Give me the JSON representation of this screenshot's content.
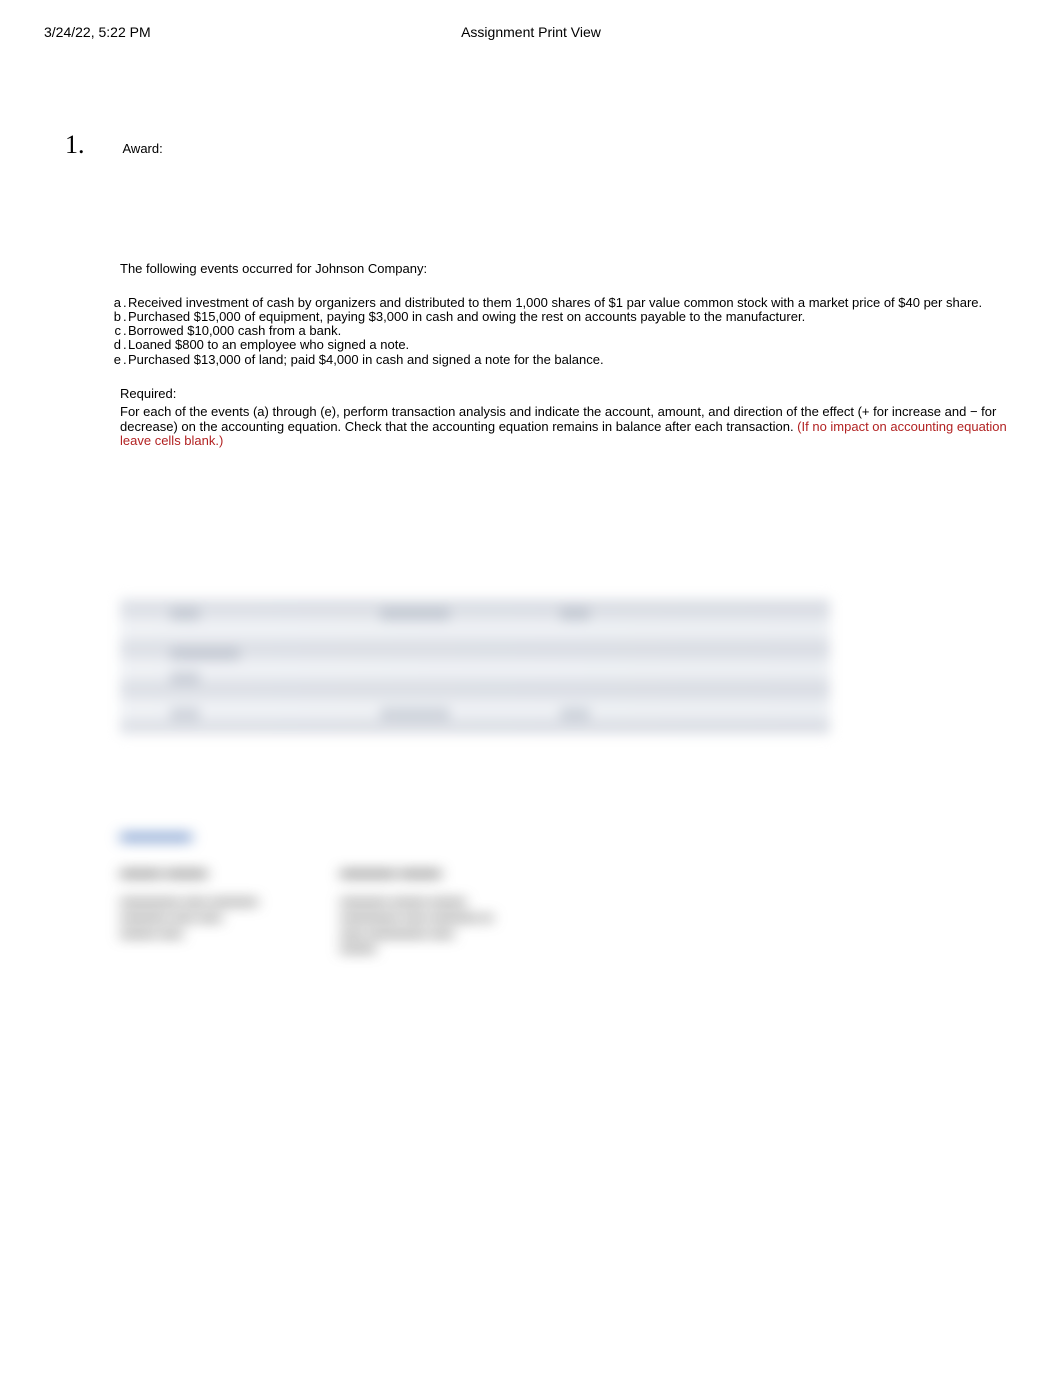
{
  "header": {
    "datetime": "3/24/22, 5:22 PM",
    "title": "Assignment Print View"
  },
  "question": {
    "number": "1.",
    "award_label": "Award:"
  },
  "intro": "The following events occurred for Johnson Company:",
  "events": [
    {
      "letter": "a",
      "text": "Received investment of cash by organizers and distributed to them 1,000 shares of $1 par value common stock with a market price of $40 per share."
    },
    {
      "letter": "b",
      "text": "Purchased $15,000 of equipment, paying $3,000 in cash and owing the rest on accounts payable to the manufacturer."
    },
    {
      "letter": "c",
      "text": "Borrowed $10,000 cash from a bank."
    },
    {
      "letter": "d",
      "text": "Loaned $800 to an employee who signed a note."
    },
    {
      "letter": "e",
      "text": "Purchased $13,000 of land; paid $4,000 in cash and signed a note for the balance."
    }
  ],
  "required": {
    "label": "Required:",
    "text_part1": "For each of the events ",
    "text_a": "(a)",
    "text_through": " through ",
    "text_e": "(e)",
    "text_part2": ", perform transaction analysis and indicate the account, amount, and direction of the effect (+ for increase and − for decrease) on the accounting equation. Check that the accounting equation remains in balance after each transaction. ",
    "red_text": "(If no impact on accounting equation leave cells blank.)"
  }
}
